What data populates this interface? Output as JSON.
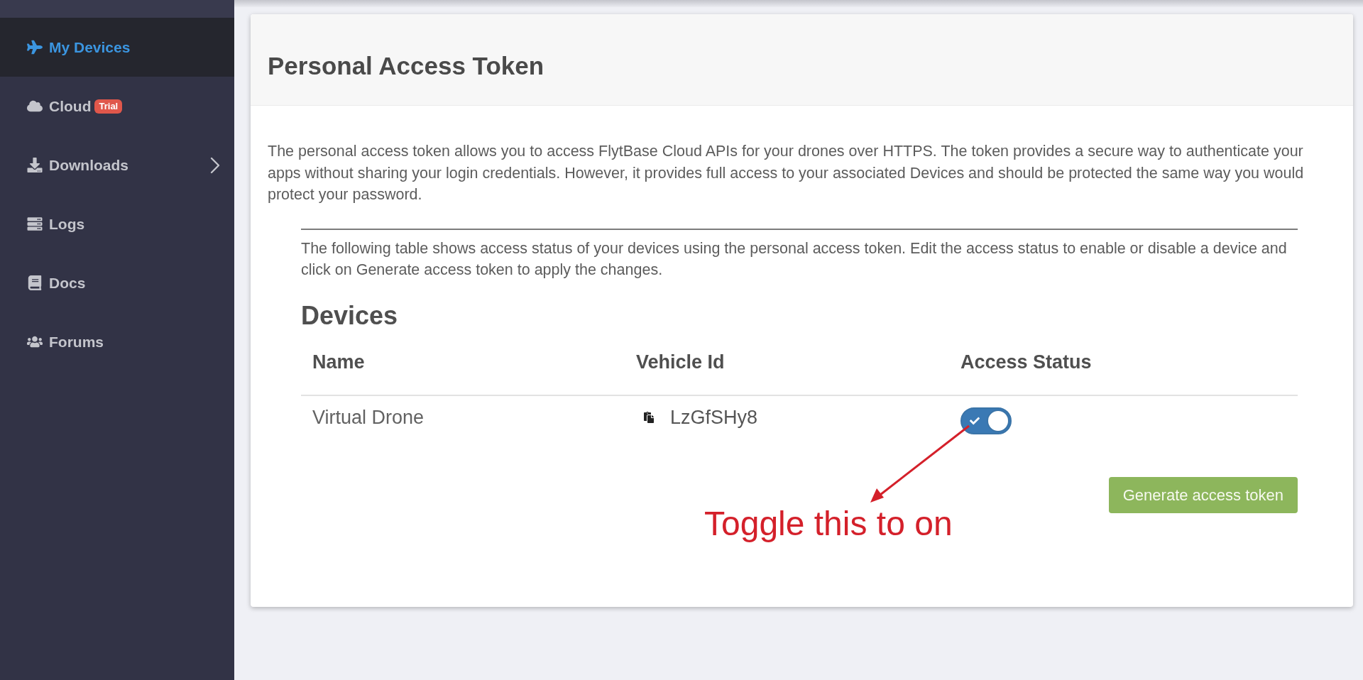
{
  "sidebar": {
    "items": [
      {
        "label": "My Devices",
        "selected": true,
        "submenu": false
      },
      {
        "label": "Cloud",
        "selected": false,
        "submenu": false,
        "badge": "Trial"
      },
      {
        "label": "Downloads",
        "selected": false,
        "submenu": true
      },
      {
        "label": "Logs",
        "selected": false,
        "submenu": false
      },
      {
        "label": "Docs",
        "selected": false,
        "submenu": false
      },
      {
        "label": "Forums",
        "selected": false,
        "submenu": false
      }
    ]
  },
  "card": {
    "title": "Personal Access Token",
    "description": "The personal access token allows you to access FlytBase Cloud APIs for your drones over HTTPS. The token provides a secure way to authenticate your apps without sharing your login credentials. However, it provides full access to your associated Devices and should be protected the same way you would protect your password.",
    "devices": {
      "intro": "The following table shows access status of your devices using the personal access token. Edit the access status to enable or disable a device and click on Generate access token to apply the changes.",
      "heading": "Devices",
      "table": {
        "columns": [
          "Name",
          "Vehicle Id",
          "Access Status"
        ],
        "rows": [
          {
            "name": "Virtual Drone",
            "vehicle_id": "LzGfSHy8",
            "access": true
          }
        ]
      },
      "button": "Generate access token"
    }
  },
  "annotation": {
    "text": "Toggle this to on"
  }
}
